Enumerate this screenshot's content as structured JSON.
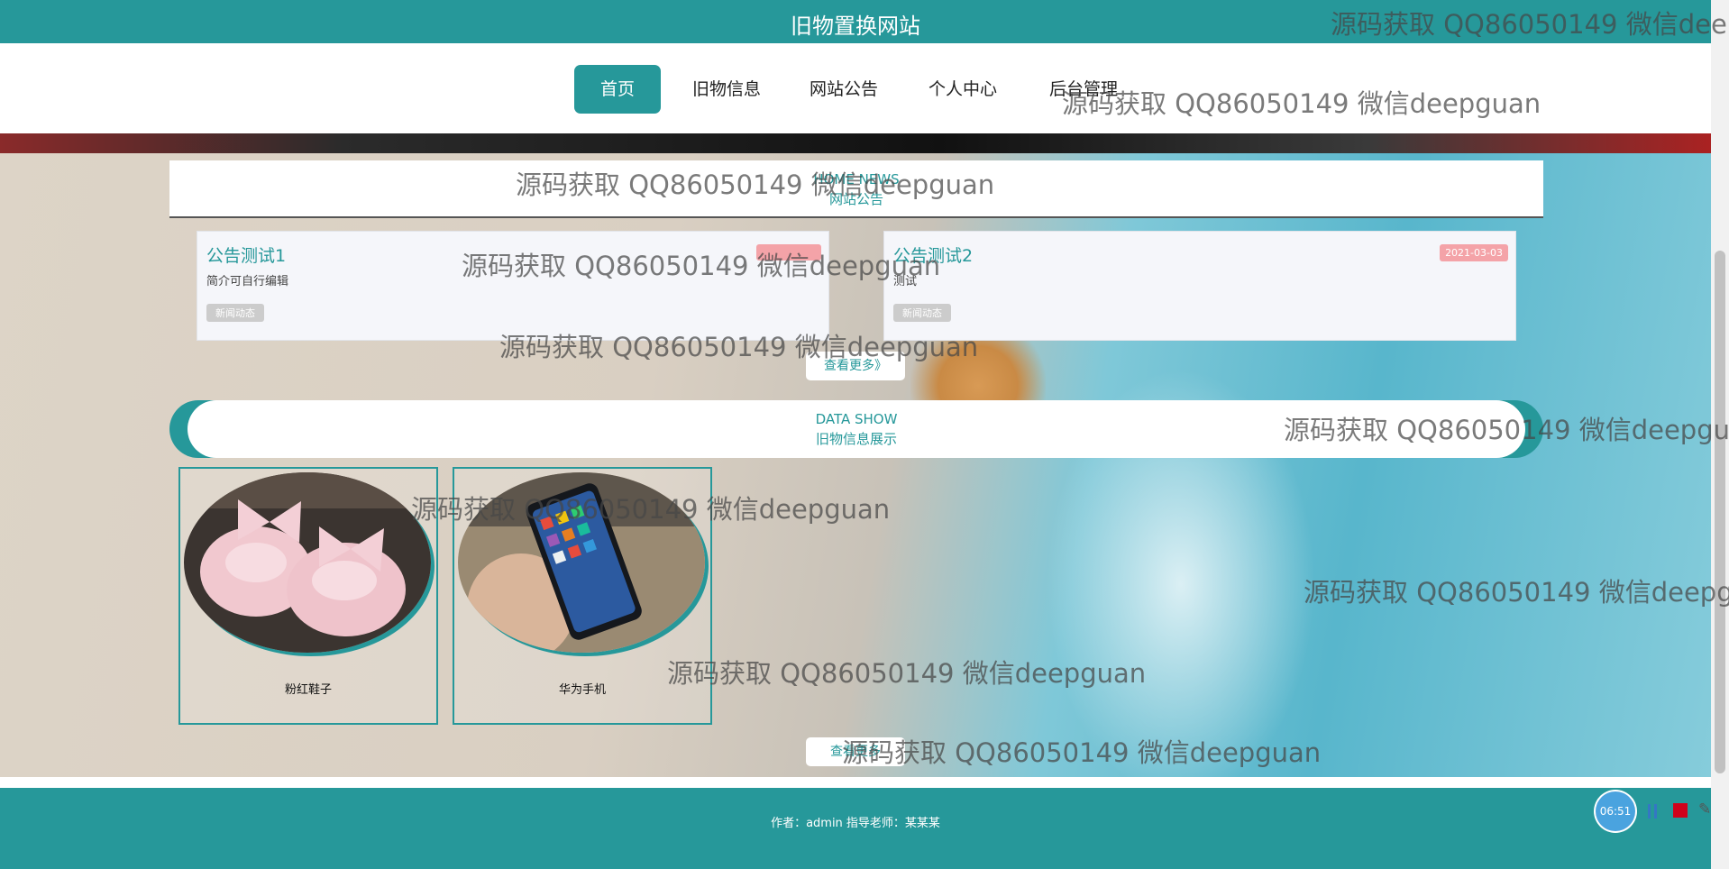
{
  "header": {
    "site_title": "旧物置换网站"
  },
  "nav": {
    "items": [
      "首页",
      "旧物信息",
      "网站公告",
      "个人中心",
      "后台管理"
    ]
  },
  "news_section": {
    "en": "HOME NEWS",
    "cn": "网站公告"
  },
  "news": [
    {
      "title": "公告测试1",
      "desc": "简介可自行编辑",
      "date": "",
      "tag": "新闻动态"
    },
    {
      "title": "公告测试2",
      "desc": "测试",
      "date": "2021-03-03",
      "tag": "新闻动态"
    }
  ],
  "more_label": "查看更多》",
  "data_section": {
    "en": "DATA SHOW",
    "cn": "旧物信息展示"
  },
  "products": [
    {
      "name": "粉红鞋子"
    },
    {
      "name": "华为手机"
    }
  ],
  "more_label2": "查看更多",
  "footer": {
    "text": "作者：admin 指导老师：某某某"
  },
  "watermark": "源码获取 QQ86050149 微信deepguan",
  "recorder": {
    "time": "06:51"
  },
  "colors": {
    "accent": "#26989a",
    "date_badge": "#f4a3a8",
    "record_red": "#d0021b"
  }
}
